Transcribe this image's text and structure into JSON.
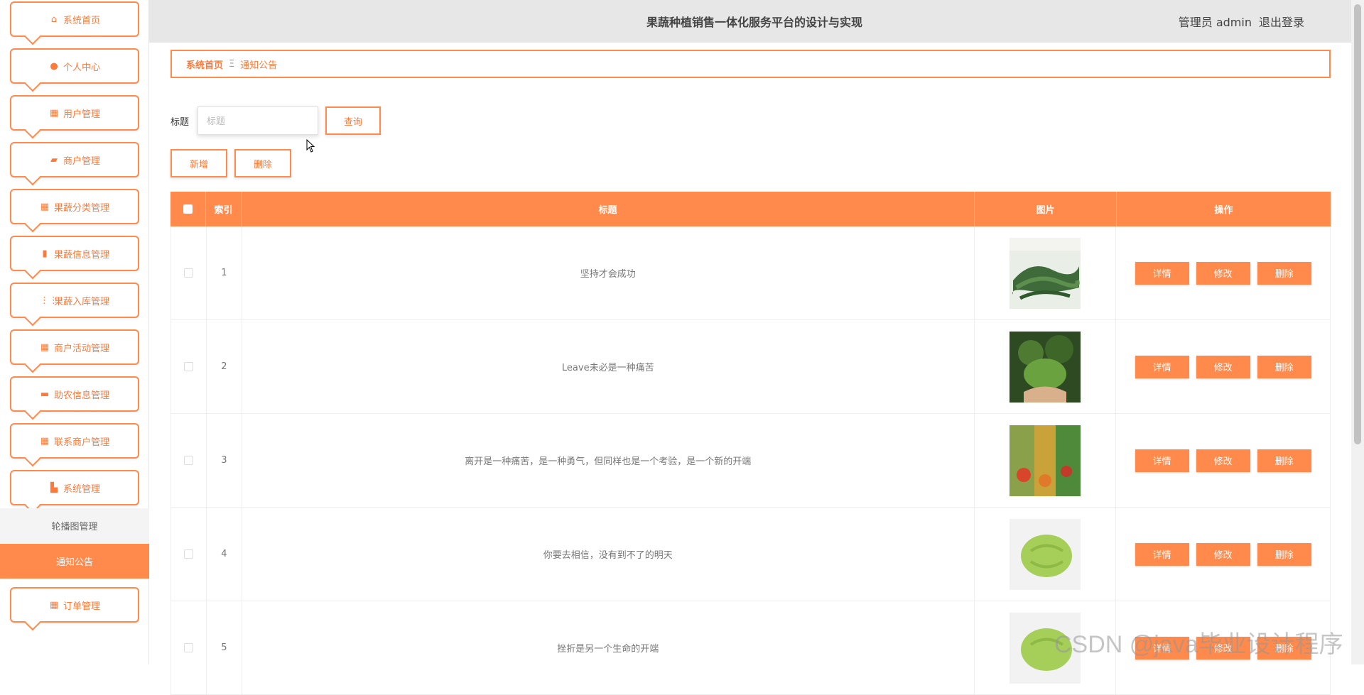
{
  "header": {
    "title": "果蔬种植销售一体化服务平台的设计与实现",
    "user": "管理员 admin",
    "logout": "退出登录"
  },
  "sidebar": {
    "items": [
      {
        "label": "系统首页",
        "icon": "home-icon"
      },
      {
        "label": "个人中心",
        "icon": "user-icon"
      },
      {
        "label": "用户管理",
        "icon": "grid-icon"
      },
      {
        "label": "商户管理",
        "icon": "briefcase-icon"
      },
      {
        "label": "果蔬分类管理",
        "icon": "grid-icon"
      },
      {
        "label": "果蔬信息管理",
        "icon": "clipboard-icon"
      },
      {
        "label": "果蔬入库管理",
        "icon": "apps-icon"
      },
      {
        "label": "商户活动管理",
        "icon": "grid-icon"
      },
      {
        "label": "助农信息管理",
        "icon": "chat-icon"
      },
      {
        "label": "联系商户管理",
        "icon": "grid-icon"
      },
      {
        "label": "系统管理",
        "icon": "cog-icon"
      }
    ],
    "subitems": [
      {
        "label": "轮播图管理",
        "active": false
      },
      {
        "label": "通知公告",
        "active": true
      }
    ],
    "last_item": {
      "label": "订单管理",
      "icon": "grid-icon"
    }
  },
  "breadcrumb": {
    "home": "系统首页",
    "separator": "Ξ",
    "current": "通知公告"
  },
  "search": {
    "label": "标题",
    "placeholder": "标题",
    "value": "",
    "query_button": "查询"
  },
  "actions": {
    "add": "新增",
    "delete": "删除"
  },
  "table": {
    "headers": [
      "索引",
      "标题",
      "图片",
      "操作"
    ],
    "rows": [
      {
        "index": "1",
        "title": "坚持才会成功"
      },
      {
        "index": "2",
        "title": "Leave未必是一种痛苦"
      },
      {
        "index": "3",
        "title": "离开是一种痛苦，是一种勇气，但同样也是一个考验，是一个新的开端"
      },
      {
        "index": "4",
        "title": "你要去相信，没有到不了的明天"
      },
      {
        "index": "5",
        "title": "挫折是另一个生命的开端"
      }
    ],
    "row_actions": {
      "detail": "详情",
      "edit": "修改",
      "delete": "删除"
    }
  },
  "watermark": "CSDN @java毕业设计程序",
  "colors": {
    "accent": "#ff8a4c",
    "header_bg": "#e7e7e8"
  }
}
